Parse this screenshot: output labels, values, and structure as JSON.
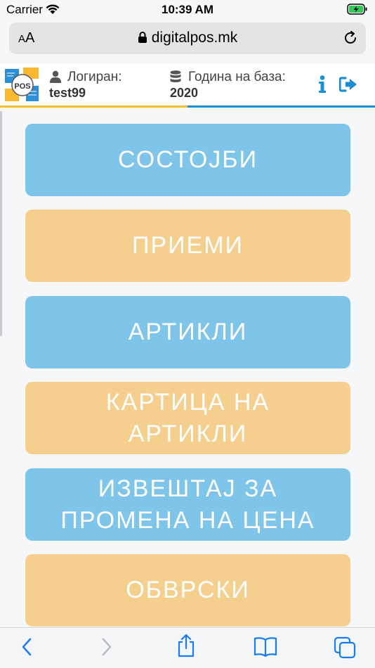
{
  "status_bar": {
    "carrier": "Carrier",
    "time": "10:39 AM"
  },
  "browser": {
    "text_size_label_small": "A",
    "text_size_label_large": "A",
    "url": "digitalpos.mk"
  },
  "header": {
    "logged_in_label": "Логиран:",
    "logged_in_user": "test99",
    "db_year_label": "Година на база:",
    "db_year_value": "2020",
    "logo_text": "POS"
  },
  "menu": [
    {
      "label": "СОСТОЈБИ",
      "color": "#7fc4e9"
    },
    {
      "label": "ПРИЕМИ",
      "color": "#f5cf8d"
    },
    {
      "label": "АРТИКЛИ",
      "color": "#7fc4e9"
    },
    {
      "label": "КАРТИЦА НА АРТИКЛИ",
      "color": "#f5cf8d"
    },
    {
      "label": "ИЗВЕШТАЈ ЗА ПРОМЕНА НА ЦЕНА",
      "color": "#7fc4e9"
    },
    {
      "label": "ОБВРСКИ",
      "color": "#f5cf8d"
    }
  ],
  "colors": {
    "accent_blue": "#1b8fd6",
    "accent_yellow": "#f2c230",
    "ios_blue": "#1a7cf5"
  },
  "toolbar_icons": [
    "back-icon",
    "forward-icon",
    "share-icon",
    "bookmarks-icon",
    "tabs-icon"
  ]
}
